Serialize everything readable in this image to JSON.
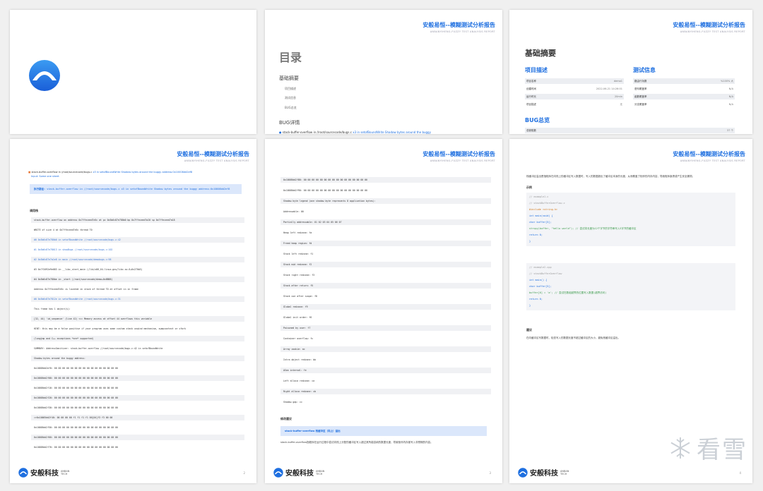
{
  "report": {
    "title": "安般易恒--模糊测试分析报告",
    "subtitle": "ANBANYIHENG-FUZZY TEST ANALYSIS REPORT"
  },
  "footer": {
    "company": "安般科技",
    "company_en_line1": "ANBAN",
    "company_en_line2": "TECH"
  },
  "toc": {
    "title": "目录",
    "basic": "基础摘要",
    "items": [
      "项目描述",
      "测试信息",
      "BUG总览"
    ],
    "bug_section": "BUG详情",
    "bug_entry": {
      "type": "stack-buffer-overflow",
      "sep": "in",
      "path": "//root/sourcecode/bugs.c",
      "desc": "x3 in setofBoundWrite Shadow bytes around the buggy"
    }
  },
  "summary": {
    "title": "基础摘要",
    "project_section": "项目描述",
    "test_section": "测试信息",
    "bug_section": "BUG总览",
    "project_rows": [
      {
        "k": "项目名称",
        "v": "demo1"
      },
      {
        "k": "创建时间",
        "v": "2022-06-21 14:26:01"
      },
      {
        "k": "运行时长",
        "v": "20min"
      },
      {
        "k": "项目描述",
        "v": "无"
      }
    ],
    "test_rows": [
      {
        "k": "路由行功数",
        "v": "%100% 大"
      },
      {
        "k": "语句覆盖率",
        "v": "N/A"
      },
      {
        "k": "函数覆盖率",
        "v": "N/A"
      },
      {
        "k": "分支覆盖率",
        "v": "N/A"
      }
    ],
    "bug_row": {
      "k": "总缺陷数",
      "v": "37 个"
    }
  },
  "page4": {
    "bug_line": {
      "type": "stack-buffer-overflow",
      "sep": "in",
      "path": "//root/sourcecode/bugs.c",
      "desc": "x3 in setofBoundWrite Shadow bytes around the buggy address:0x10008dd2ef8",
      "desc2": "Input: Some one sheet"
    },
    "highlight_label": "执行路径:",
    "highlight_text": "stack-buffer-overflow in //root/sourcecode/bugs.c x3 in setofBoundWrite Shadow bytes around the buggy address:0x10008dd2ef8",
    "section": "调用栈",
    "lines": [
      "stack-buffer-overflow on address 0x7ffeceed7e5c at pc 0x5b6c87e780b0 bp 0x7ffeceed7a20 sp 0x7ffeceed7a18",
      "WRITE of size 4 at 0x7ffeceed7e5c thread T0",
      "#0 0x5b6c87e780b0 in setofBoundWrite //root/sourcecode/bugs.c:42",
      "#1 0x5b6c87e78013 in showBugs //root/sourcecode/bugs.c:102",
      "#2 0x5b6c87e7a1e8 in main //root/sourcecode/demobugs.c:98",
      "#3 0x7f2092e9e083 in __libc_start_main (/lib/x86_64-linux-gnu/libc.so.6+0x270b3)",
      "#4 0x5b6c87e780be in _start (/root/sourcecode/demo+0x8B88)",
      "Address 0x7ffeceed7e5c is located in stack of thread T0 at offset in in frame",
      "#0 0x5b6c87e7812e in setofBoundWrite //root/sourcecode/bugs.c:31",
      "This frame has 1 object(s):",
      "[32, 44) 'id_sequence' (line 42) <== Memory access at offset 44 overflows this variable",
      "HINT: this may be a false positive if your program uses some custom stack unwind mechanism, swapcontext or vfork",
      "(longjmp and C++ exceptions *are* supported)",
      "SUMMARY: AddressSanitizer: stack-buffer-overflow //root/sourcecode/bugs.c:42 in setofBoundWrite",
      "Shadow bytes around the buggy address:",
      "0x10005dd2ef0: 00 00 00 00 00 00 00 00 00 00 00 00 00 00 00 00",
      "0x10005dd2f00: 00 00 00 00 00 00 00 00 00 00 00 00 00 00 00 00",
      "0x10005dd2f10: 00 00 00 00 00 00 00 00 00 00 00 00 00 00 00 00",
      "0x10005dd2f20: 00 00 00 00 00 00 00 00 00 00 00 00 00 00 00 00",
      "0x10005dd2f30: 00 00 00 00 00 00 00 00 00 00 00 00 00 00 00 00",
      "=>0x10005dd2f40: 00 00 00 00 f1 f1 f1 f1 00[04]f3 f3 00 00",
      "0x10005dd2f50: 00 00 00 00 00 00 00 00 00 00 00 00 00 00 00 00",
      "0x10005dd2f60: 00 00 00 00 00 00 00 00 00 00 00 00 00 00 00 00",
      "0x10005dd2f70: 00 00 00 00 00 00 00 00 00 00 00 00 00 00 00 00"
    ],
    "page": "2"
  },
  "page5": {
    "lines": [
      "0x10005dd2f80: 00 00 00 00 00 00 00 00 00 00 00 00 00 00 00 00",
      "0x10005dd2f90: 00 00 00 00 00 00 00 00 00 00 00 00 00 00 00 00",
      "Shadow byte legend (one shadow byte represents 8 application bytes):",
      "Addressable:      00",
      "Partially addressable: 01 02 03 04 05 06 07",
      "Heap left redzone:     fa",
      "Freed heap region:     fd",
      "Stack left redzone:    f1",
      "Stack mid redzone:     f2",
      "Stack right redzone:   f3",
      "Stack after return:    f5",
      "Stack use after scope: f8",
      "Global redzone:        f9",
      "Global init order:     f6",
      "Poisoned by user:      f7",
      "Container overflow:    fc",
      "Array cookie:          ac",
      "Intra object redzone:  bb",
      "ASan internal:         fe",
      "Left alloca redzone:   ca",
      "Right alloca redzone:  cb",
      "Shadow gap:            cc"
    ],
    "fix_section": "修改建议",
    "fix_highlight": "stack-buffer-overflow 栈缓冲区（向上）溢出",
    "fix_text": "stack-buffer-overflow指程序在运行过程中尝试向栈上分配的缓冲区写入超过其所能容纳的数据长度，导致相邻内存被写入非预期的内容。",
    "page": "3"
  },
  "page6": {
    "intro": "栈缓冲区溢出是指程序在向栈上的缓冲区写入数据时，写入的数据超出了缓冲区本身的长度，从而覆盖了相邻的内存内容，导致程序崩溃或产生安全漏洞。",
    "example_title": "示例",
    "code1": [
      {
        "t": "// example1.c",
        "c": "c-gray"
      },
      {
        "t": "// stackBufferOverflow.c",
        "c": "c-gray"
      },
      {
        "t": "#include <string.h>",
        "c": "c-org"
      },
      {
        "t": "int main(void) {",
        "c": "c-blue"
      },
      {
        "t": "    char buffer[5];",
        "c": "c-blue"
      },
      {
        "t": "    strcpy(buffer, \"hello world\");  // 尝试将长度为12个字节的字符串写入5字节的缓冲区",
        "c": "c-grn"
      },
      {
        "t": "    return 0;",
        "c": "c-blue"
      },
      {
        "t": "}",
        "c": "c-blue"
      }
    ],
    "code2": [
      {
        "t": "// example2.cpp",
        "c": "c-gray"
      },
      {
        "t": "// stackBufferOverflow",
        "c": "c-gray"
      },
      {
        "t": "int main() {",
        "c": "c-blue"
      },
      {
        "t": "    char buffer[5];",
        "c": "c-blue"
      },
      {
        "t": "    buffer[6] = 'a';  // 尝试在数组越界的位置写入数据(越界访问)",
        "c": "c-grn"
      },
      {
        "t": "    return 0;",
        "c": "c-blue"
      },
      {
        "t": "}",
        "c": "c-blue"
      }
    ],
    "advice_title": "建议",
    "advice_text": "在向缓冲区写数据时，检查写入的数据长度不超过缓冲区的大小，避免栈缓冲区溢出。",
    "page": "4"
  },
  "watermark": {
    "text": "看雪"
  },
  "colors": {
    "accent": "#1e6fe0",
    "highlight_bg": "#dbe7fb",
    "row_shade": "#f0f1f4"
  }
}
